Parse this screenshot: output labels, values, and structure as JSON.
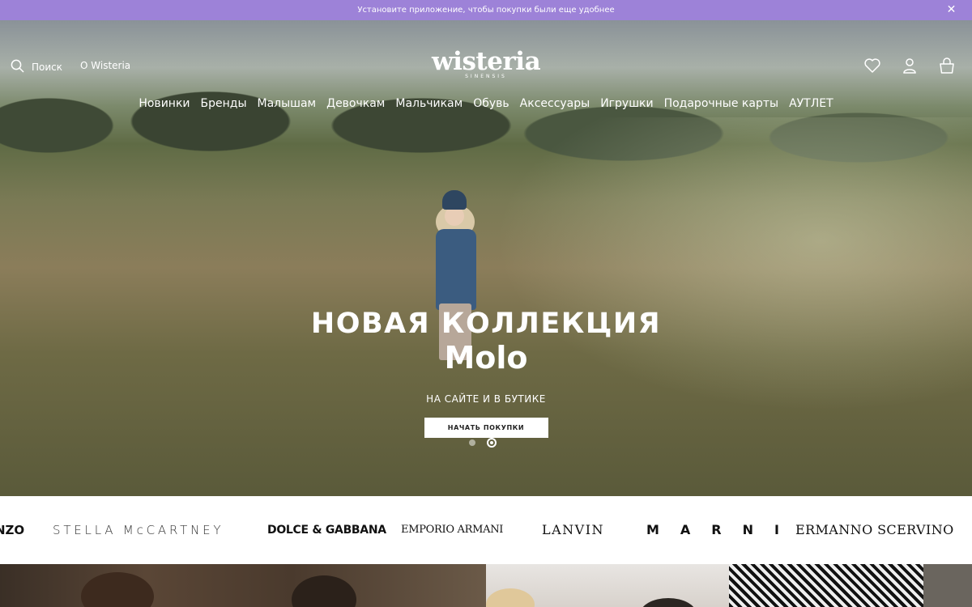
{
  "banner": {
    "text": "Установите приложение, чтобы покупки были еще удобнее",
    "close_icon": "close-icon"
  },
  "header": {
    "search_label": "Поиск",
    "about_label": "О Wisteria",
    "logo_text": "wisteria",
    "logo_subtext": "SINENSIS",
    "icons": [
      "heart-icon",
      "user-icon",
      "bag-icon"
    ]
  },
  "nav": {
    "items": [
      {
        "label": "Новинки"
      },
      {
        "label": "Бренды"
      },
      {
        "label": "Малышам"
      },
      {
        "label": "Девочкам"
      },
      {
        "label": "Мальчикам"
      },
      {
        "label": "Обувь"
      },
      {
        "label": "Аксессуары"
      },
      {
        "label": "Игрушки"
      },
      {
        "label": "Подарочные карты"
      },
      {
        "label": "АУТЛЕТ"
      }
    ]
  },
  "hero": {
    "title": "НОВАЯ КОЛЛЕКЦИЯ",
    "brand": "Molo",
    "subtitle": "НА САЙТЕ И В БУТИКЕ",
    "cta_label": "НАЧАТЬ ПОКУПКИ",
    "slides_count": 2,
    "active_slide": 2
  },
  "brands": {
    "items": [
      {
        "label": "NZO"
      },
      {
        "label": "STELLA McCARTNEY"
      },
      {
        "label": "DOLCE & GABBANA"
      },
      {
        "label": "EMPORIO ARMANI"
      },
      {
        "label": "LANVIN"
      },
      {
        "label": "MARNI"
      },
      {
        "label": "ERMANNO SCERVINO"
      }
    ]
  },
  "colors": {
    "banner_bg": "#9d82d8",
    "cta_bg": "#ffffff",
    "cta_text": "#222222"
  }
}
